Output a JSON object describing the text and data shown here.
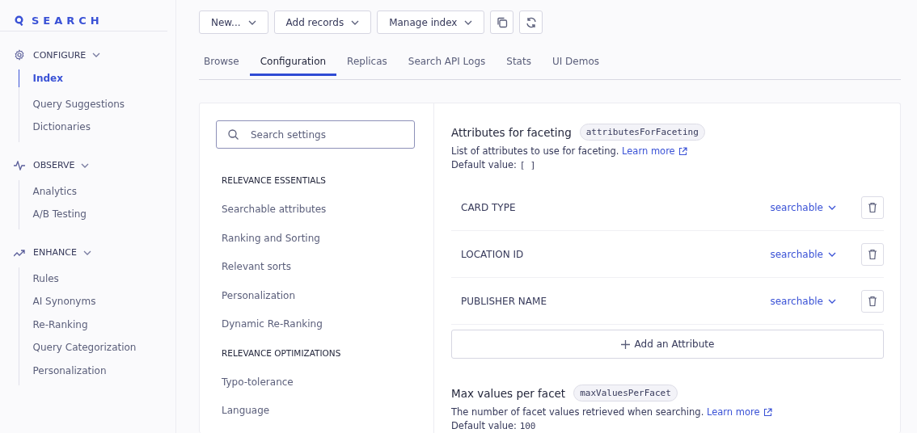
{
  "logo": "SEARCH",
  "sidebar": {
    "groups": [
      {
        "title": "CONFIGURE",
        "expanded": true,
        "items": [
          {
            "label": "Index",
            "selected": true
          },
          {
            "label": "Query Suggestions",
            "selected": false
          },
          {
            "label": "Dictionaries",
            "selected": false
          }
        ]
      },
      {
        "title": "OBSERVE",
        "expanded": true,
        "items": [
          {
            "label": "Analytics",
            "selected": false
          },
          {
            "label": "A/B Testing",
            "selected": false
          }
        ]
      },
      {
        "title": "ENHANCE",
        "expanded": true,
        "items": [
          {
            "label": "Rules",
            "selected": false
          },
          {
            "label": "AI Synonyms",
            "selected": false
          },
          {
            "label": "Re-Ranking",
            "selected": false
          },
          {
            "label": "Query Categorization",
            "selected": false
          },
          {
            "label": "Personalization",
            "selected": false
          }
        ]
      }
    ]
  },
  "toolbar": [
    {
      "kind": "dropdown",
      "label": "New..."
    },
    {
      "kind": "dropdown",
      "label": "Add records"
    },
    {
      "kind": "dropdown",
      "label": "Manage index"
    },
    {
      "kind": "copy"
    },
    {
      "kind": "refresh"
    }
  ],
  "tabs": [
    {
      "label": "Browse",
      "selected": false
    },
    {
      "label": "Configuration",
      "selected": true
    },
    {
      "label": "Replicas",
      "selected": false
    },
    {
      "label": "Search API Logs",
      "selected": false
    },
    {
      "label": "Stats",
      "selected": false
    },
    {
      "label": "UI Demos",
      "selected": false
    }
  ],
  "settings_search": {
    "placeholder": "Search settings"
  },
  "settings_nav": [
    {
      "kind": "heading",
      "label": "RELEVANCE ESSENTIALS"
    },
    {
      "kind": "link",
      "label": "Searchable attributes"
    },
    {
      "kind": "link",
      "label": "Ranking and Sorting"
    },
    {
      "kind": "link",
      "label": "Relevant sorts"
    },
    {
      "kind": "link",
      "label": "Personalization"
    },
    {
      "kind": "link",
      "label": "Dynamic Re-Ranking"
    },
    {
      "kind": "heading",
      "label": "RELEVANCE OPTIMIZATIONS"
    },
    {
      "kind": "link",
      "label": "Typo-tolerance"
    },
    {
      "kind": "link",
      "label": "Language"
    }
  ],
  "sections": [
    {
      "title": "Attributes for faceting",
      "key": "attributesForFaceting",
      "description": "List of attributes to use for faceting.",
      "link": "Learn more",
      "default_label": "Default value:",
      "default_value": "[ ]",
      "attributes": [
        {
          "name": "CARD TYPE",
          "mode": "searchable"
        },
        {
          "name": "LOCATION ID",
          "mode": "searchable"
        },
        {
          "name": "PUBLISHER NAME",
          "mode": "searchable"
        }
      ],
      "add_button": "Add an Attribute"
    },
    {
      "title": "Max values per facet",
      "key": "maxValuesPerFacet",
      "description": "The number of facet values retrieved when searching.",
      "link": "Learn more",
      "default_label": "Default value:",
      "default_value": "100"
    }
  ]
}
